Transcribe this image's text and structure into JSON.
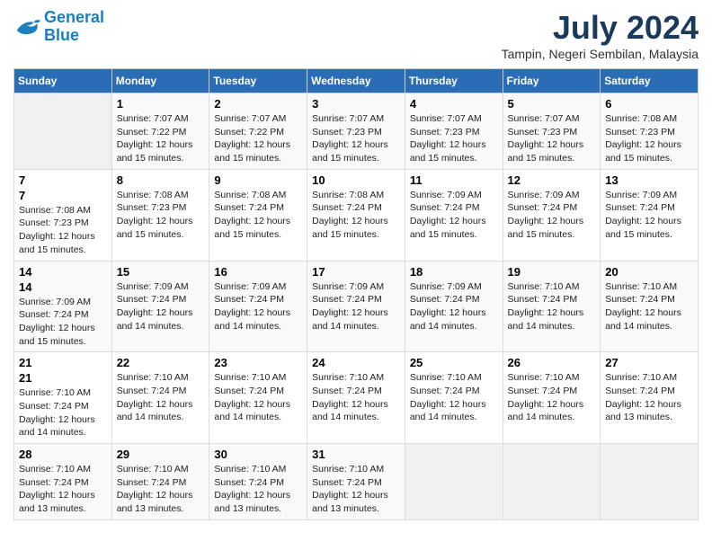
{
  "header": {
    "logo_line1": "General",
    "logo_line2": "Blue",
    "month_title": "July 2024",
    "location": "Tampin, Negeri Sembilan, Malaysia"
  },
  "weekdays": [
    "Sunday",
    "Monday",
    "Tuesday",
    "Wednesday",
    "Thursday",
    "Friday",
    "Saturday"
  ],
  "weeks": [
    [
      {
        "day": "",
        "info": ""
      },
      {
        "day": "1",
        "info": "Sunrise: 7:07 AM\nSunset: 7:22 PM\nDaylight: 12 hours\nand 15 minutes."
      },
      {
        "day": "2",
        "info": "Sunrise: 7:07 AM\nSunset: 7:22 PM\nDaylight: 12 hours\nand 15 minutes."
      },
      {
        "day": "3",
        "info": "Sunrise: 7:07 AM\nSunset: 7:23 PM\nDaylight: 12 hours\nand 15 minutes."
      },
      {
        "day": "4",
        "info": "Sunrise: 7:07 AM\nSunset: 7:23 PM\nDaylight: 12 hours\nand 15 minutes."
      },
      {
        "day": "5",
        "info": "Sunrise: 7:07 AM\nSunset: 7:23 PM\nDaylight: 12 hours\nand 15 minutes."
      },
      {
        "day": "6",
        "info": "Sunrise: 7:08 AM\nSunset: 7:23 PM\nDaylight: 12 hours\nand 15 minutes."
      }
    ],
    [
      {
        "day": "7",
        "info": ""
      },
      {
        "day": "8",
        "info": "Sunrise: 7:08 AM\nSunset: 7:23 PM\nDaylight: 12 hours\nand 15 minutes."
      },
      {
        "day": "9",
        "info": "Sunrise: 7:08 AM\nSunset: 7:24 PM\nDaylight: 12 hours\nand 15 minutes."
      },
      {
        "day": "10",
        "info": "Sunrise: 7:08 AM\nSunset: 7:24 PM\nDaylight: 12 hours\nand 15 minutes."
      },
      {
        "day": "11",
        "info": "Sunrise: 7:09 AM\nSunset: 7:24 PM\nDaylight: 12 hours\nand 15 minutes."
      },
      {
        "day": "12",
        "info": "Sunrise: 7:09 AM\nSunset: 7:24 PM\nDaylight: 12 hours\nand 15 minutes."
      },
      {
        "day": "13",
        "info": "Sunrise: 7:09 AM\nSunset: 7:24 PM\nDaylight: 12 hours\nand 15 minutes."
      }
    ],
    [
      {
        "day": "14",
        "info": ""
      },
      {
        "day": "15",
        "info": "Sunrise: 7:09 AM\nSunset: 7:24 PM\nDaylight: 12 hours\nand 14 minutes."
      },
      {
        "day": "16",
        "info": "Sunrise: 7:09 AM\nSunset: 7:24 PM\nDaylight: 12 hours\nand 14 minutes."
      },
      {
        "day": "17",
        "info": "Sunrise: 7:09 AM\nSunset: 7:24 PM\nDaylight: 12 hours\nand 14 minutes."
      },
      {
        "day": "18",
        "info": "Sunrise: 7:09 AM\nSunset: 7:24 PM\nDaylight: 12 hours\nand 14 minutes."
      },
      {
        "day": "19",
        "info": "Sunrise: 7:10 AM\nSunset: 7:24 PM\nDaylight: 12 hours\nand 14 minutes."
      },
      {
        "day": "20",
        "info": "Sunrise: 7:10 AM\nSunset: 7:24 PM\nDaylight: 12 hours\nand 14 minutes."
      }
    ],
    [
      {
        "day": "21",
        "info": ""
      },
      {
        "day": "22",
        "info": "Sunrise: 7:10 AM\nSunset: 7:24 PM\nDaylight: 12 hours\nand 14 minutes."
      },
      {
        "day": "23",
        "info": "Sunrise: 7:10 AM\nSunset: 7:24 PM\nDaylight: 12 hours\nand 14 minutes."
      },
      {
        "day": "24",
        "info": "Sunrise: 7:10 AM\nSunset: 7:24 PM\nDaylight: 12 hours\nand 14 minutes."
      },
      {
        "day": "25",
        "info": "Sunrise: 7:10 AM\nSunset: 7:24 PM\nDaylight: 12 hours\nand 14 minutes."
      },
      {
        "day": "26",
        "info": "Sunrise: 7:10 AM\nSunset: 7:24 PM\nDaylight: 12 hours\nand 14 minutes."
      },
      {
        "day": "27",
        "info": "Sunrise: 7:10 AM\nSunset: 7:24 PM\nDaylight: 12 hours\nand 13 minutes."
      }
    ],
    [
      {
        "day": "28",
        "info": "Sunrise: 7:10 AM\nSunset: 7:24 PM\nDaylight: 12 hours\nand 13 minutes."
      },
      {
        "day": "29",
        "info": "Sunrise: 7:10 AM\nSunset: 7:24 PM\nDaylight: 12 hours\nand 13 minutes."
      },
      {
        "day": "30",
        "info": "Sunrise: 7:10 AM\nSunset: 7:24 PM\nDaylight: 12 hours\nand 13 minutes."
      },
      {
        "day": "31",
        "info": "Sunrise: 7:10 AM\nSunset: 7:24 PM\nDaylight: 12 hours\nand 13 minutes."
      },
      {
        "day": "",
        "info": ""
      },
      {
        "day": "",
        "info": ""
      },
      {
        "day": "",
        "info": ""
      }
    ]
  ]
}
